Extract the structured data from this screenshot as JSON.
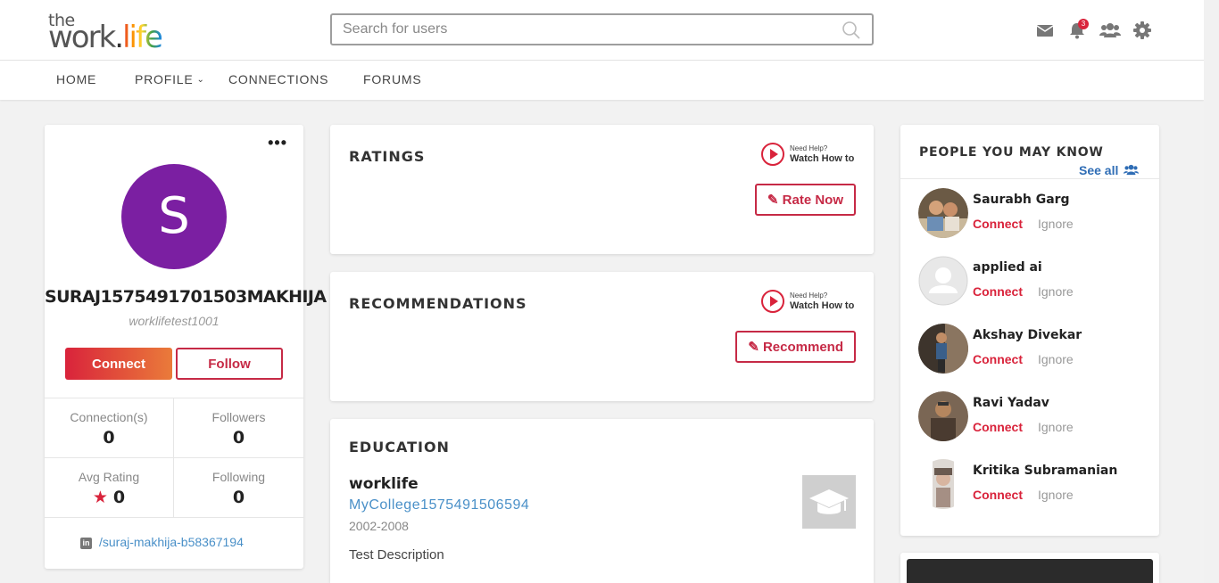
{
  "logo": {
    "the": "the",
    "work": "work",
    "dot": ".",
    "life": "life"
  },
  "search": {
    "placeholder": "Search for users"
  },
  "header": {
    "notification_count": "3"
  },
  "nav": {
    "home": "HOME",
    "profile": "PROFILE",
    "connections": "CONNECTIONS",
    "forums": "FORUMS"
  },
  "profile": {
    "avatar_letter": "S",
    "avatar_color": "#7b1fa2",
    "name": "SURAJ1575491701503MAKHIJA",
    "username": "worklifetest1001",
    "connect_label": "Connect",
    "follow_label": "Follow",
    "stats": {
      "connections_label": "Connection(s)",
      "connections": "0",
      "followers_label": "Followers",
      "followers": "0",
      "rating_label": "Avg Rating",
      "rating": "0",
      "following_label": "Following",
      "following": "0"
    },
    "linkedin": "/suraj-makhija-b58367194"
  },
  "help": {
    "small": "Need Help?",
    "big": "Watch How to"
  },
  "ratings": {
    "title": "RATINGS",
    "button": "Rate Now"
  },
  "recommendations": {
    "title": "RECOMMENDATIONS",
    "button": "Recommend"
  },
  "education": {
    "title": "EDUCATION",
    "school": "worklife",
    "college": "MyCollege1575491506594",
    "years": "2002-2008",
    "description": "Test Description"
  },
  "pymk": {
    "title": "PEOPLE YOU MAY KNOW",
    "see_all": "See all",
    "connect_label": "Connect",
    "ignore_label": "Ignore",
    "people": [
      {
        "name": "Saurabh Garg"
      },
      {
        "name": "applied ai"
      },
      {
        "name": "Akshay Divekar"
      },
      {
        "name": "Ravi Yadav"
      },
      {
        "name": "Kritika Subramanian"
      }
    ]
  },
  "colors": {
    "accent": "#d9233b",
    "link": "#4a90c8",
    "see_all": "#2f6db5"
  }
}
